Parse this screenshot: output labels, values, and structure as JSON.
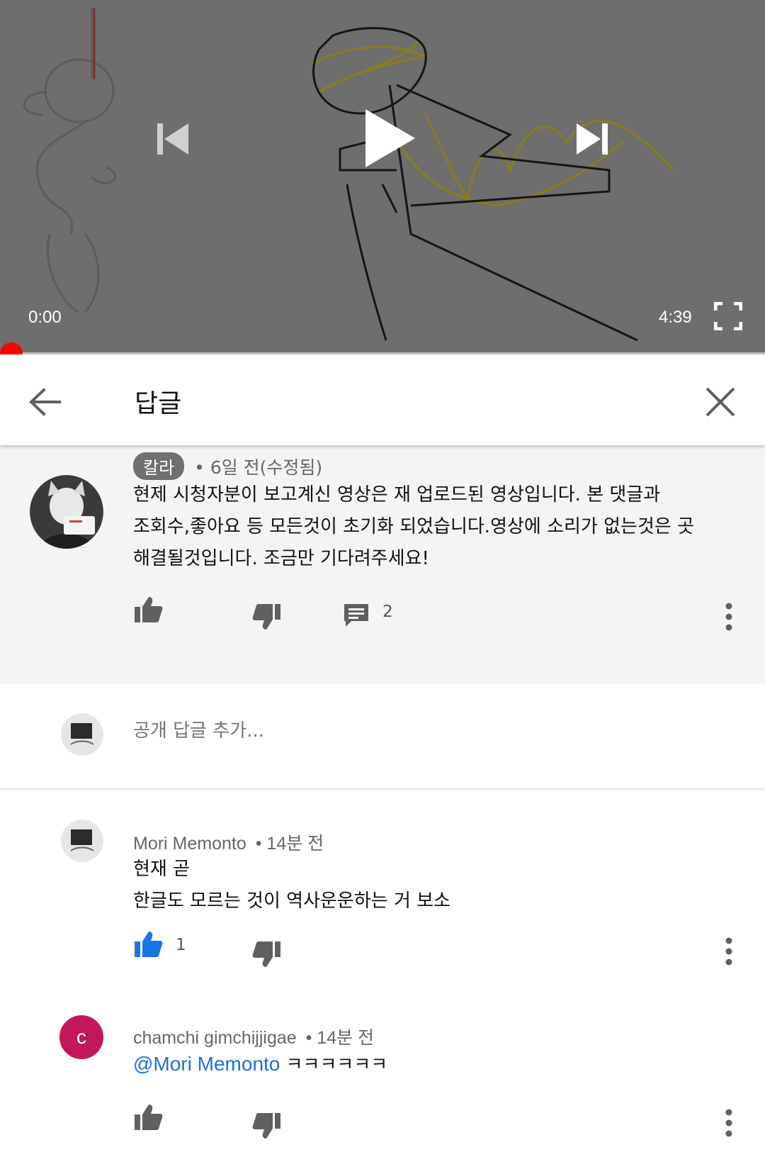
{
  "player": {
    "time_current": "0:00",
    "time_total": "4:39",
    "progress": 0,
    "accent_color": "#ff0000"
  },
  "header": {
    "title": "답글"
  },
  "main_comment": {
    "author": "칼라",
    "meta": "• 6일 전(수정됨)",
    "lines": [
      "현제 시청자분이 보고계신 영상은 재 업로드된 영상입니다. 본 댓글과",
      "조회수,좋아요 등 모든것이 초기화 되었습니다.영상에 소리가 없는것은 곳",
      "해결될것입니다. 조금만 기다려주세요!"
    ],
    "reply_count": "2"
  },
  "add_reply": {
    "placeholder": "공개 답글 추가..."
  },
  "replies": [
    {
      "author": "Mori Memonto",
      "time": "• 14분 전",
      "lines": [
        "현재 곧",
        "한글도 모르는 것이 역사운운하는 거 보소"
      ],
      "like_count": "1",
      "liked": true
    },
    {
      "author": "chamchi gimchijjigae",
      "time": "• 14분 전",
      "avatar_letter": "c",
      "avatar_color": "#c2185b",
      "mention": "@Mori Memonto",
      "text": " ㅋㅋㅋㅋㅋㅋ"
    }
  ],
  "colors": {
    "like_active": "#1a73e8",
    "icon_gray": "#555555"
  }
}
